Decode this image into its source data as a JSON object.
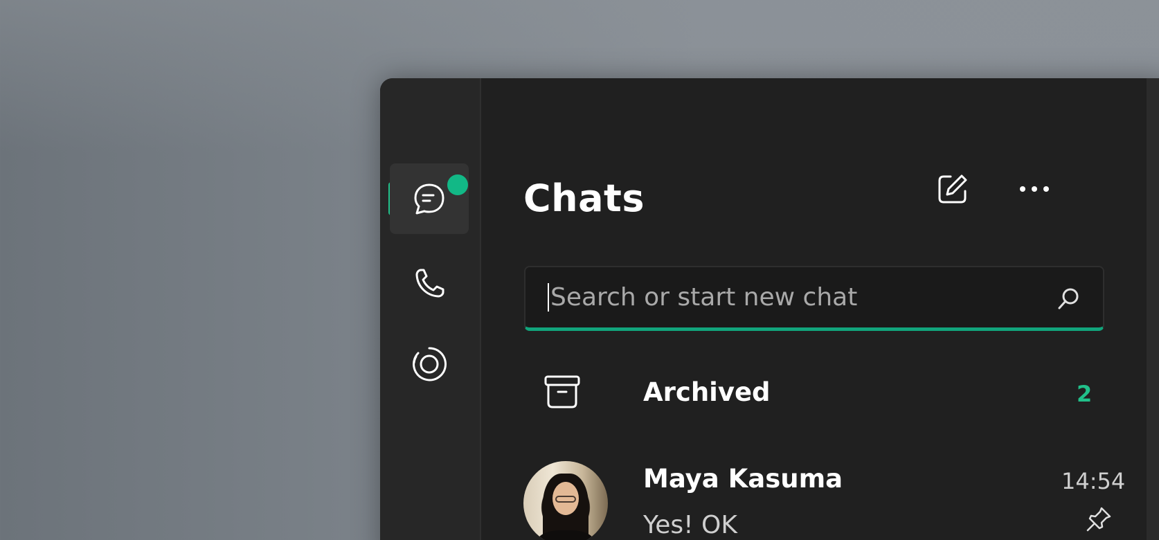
{
  "sidebar": {
    "items": [
      {
        "name": "chats",
        "icon": "chat-icon",
        "active": true,
        "has_badge": true
      },
      {
        "name": "calls",
        "icon": "phone-icon",
        "active": false
      },
      {
        "name": "status",
        "icon": "status-icon",
        "active": false
      }
    ]
  },
  "header": {
    "title": "Chats",
    "actions": [
      {
        "icon": "new-chat-icon"
      },
      {
        "icon": "more-options-icon"
      }
    ]
  },
  "search": {
    "placeholder": "Search or start new chat",
    "value": ""
  },
  "archived": {
    "label": "Archived",
    "count": "2"
  },
  "chats": [
    {
      "name": "Maya Kasuma",
      "last_message": "Yes! OK",
      "time": "14:54",
      "pinned": true
    }
  ],
  "colors": {
    "accent": "#21c08a",
    "badge": "#12b886",
    "window_bg": "#202020",
    "rail_bg": "#272727"
  }
}
